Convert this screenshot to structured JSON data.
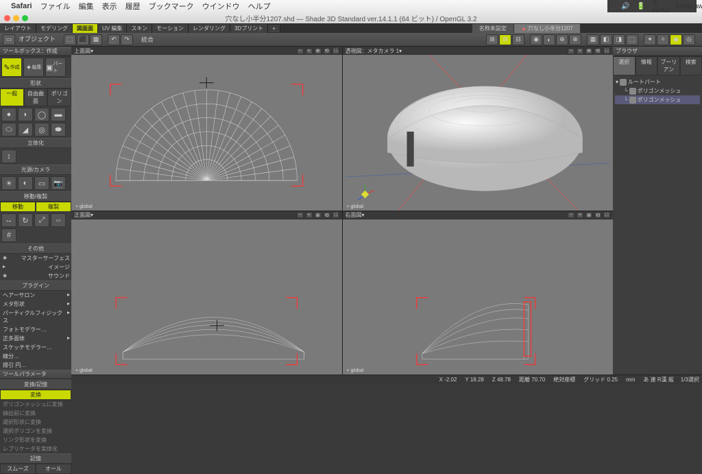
{
  "menubar": {
    "app": "Safari",
    "items": [
      "ファイル",
      "編集",
      "表示",
      "履歴",
      "ブックマーク",
      "ウインドウ",
      "ヘルプ"
    ],
    "right": {
      "time": "木 14:54",
      "user": "kanazawa"
    }
  },
  "window": {
    "title": "穴なし小半分1207.shd — Shade 3D Standard ver.14.1.1 (64 ビット) / OpenGL 3.2"
  },
  "tabstrip": [
    "レイアウト",
    "モデリング",
    "図面面",
    "UV 編集",
    "スキン",
    "モーション",
    "レンダリング",
    "3Dプリント",
    "+"
  ],
  "tabstrip_active": 2,
  "doctabs": [
    "名称未設定",
    "穴なし小半分1207"
  ],
  "doctabs_active": 1,
  "toolbar2": {
    "object": "オブジェクト",
    "integrate": "統合"
  },
  "left": {
    "toolbox": "ツールボックス：作成",
    "create": "作成",
    "edit": "編集",
    "part": "パート",
    "shape": "形状",
    "general": "一般",
    "free": "自由曲面",
    "polygon": "ポリゴン",
    "solid": "立体化",
    "light": "光源/カメラ",
    "movecopy": "移動/複製",
    "move": "移動",
    "copy": "複製",
    "other": "その他",
    "master": "マスターサーフェス",
    "image": "イメージ",
    "sound": "サウンド",
    "plugin": "プラグイン",
    "plugins": [
      "ヘアーサロン",
      "メタ形状",
      "パーティクルフィジックス",
      "フォトモデラー…",
      "正多面体",
      "スケッチモデラー…",
      "線分…",
      "掃引 円…"
    ],
    "toolparam": "ツールパラメータ",
    "transform": "変換/記憶",
    "change": "変換",
    "params": [
      "ポリゴンメッシュに変換",
      "抽出前に変換",
      "選択形状に変換",
      "選択ポリゴンを変換",
      "リンク形状を変換",
      "レプリケータを実体化"
    ],
    "memory": "記憶",
    "smooth": "スムーズ",
    "all": "オール"
  },
  "viewports": {
    "tl": {
      "name": "上面図",
      "lbl": "+ global"
    },
    "tr": {
      "name": "透視図：メタカメラ 1",
      "lbl": "+ global"
    },
    "bl": {
      "name": "正面図",
      "lbl": "+ global"
    },
    "br": {
      "name": "右面図",
      "lbl": "+ global"
    }
  },
  "browser": {
    "title": "ブラウザ",
    "tabs": [
      "選択",
      "情報",
      "ブーリアン",
      "検索"
    ],
    "root": "ルートパート",
    "mesh": "ポリゴンメッシュ"
  },
  "status": {
    "x": "X",
    "xv": "-2.02",
    "y": "Y",
    "yv": "18.28",
    "z": "Z",
    "zv": "48.78",
    "dist": "距離",
    "dv": "70.70",
    "coord": "絶対座標",
    "grid": "グリッド",
    "gv": "0.25",
    "unit": "mm",
    "ime": "あ 連 R漢 般",
    "sel": "1/3選択"
  }
}
